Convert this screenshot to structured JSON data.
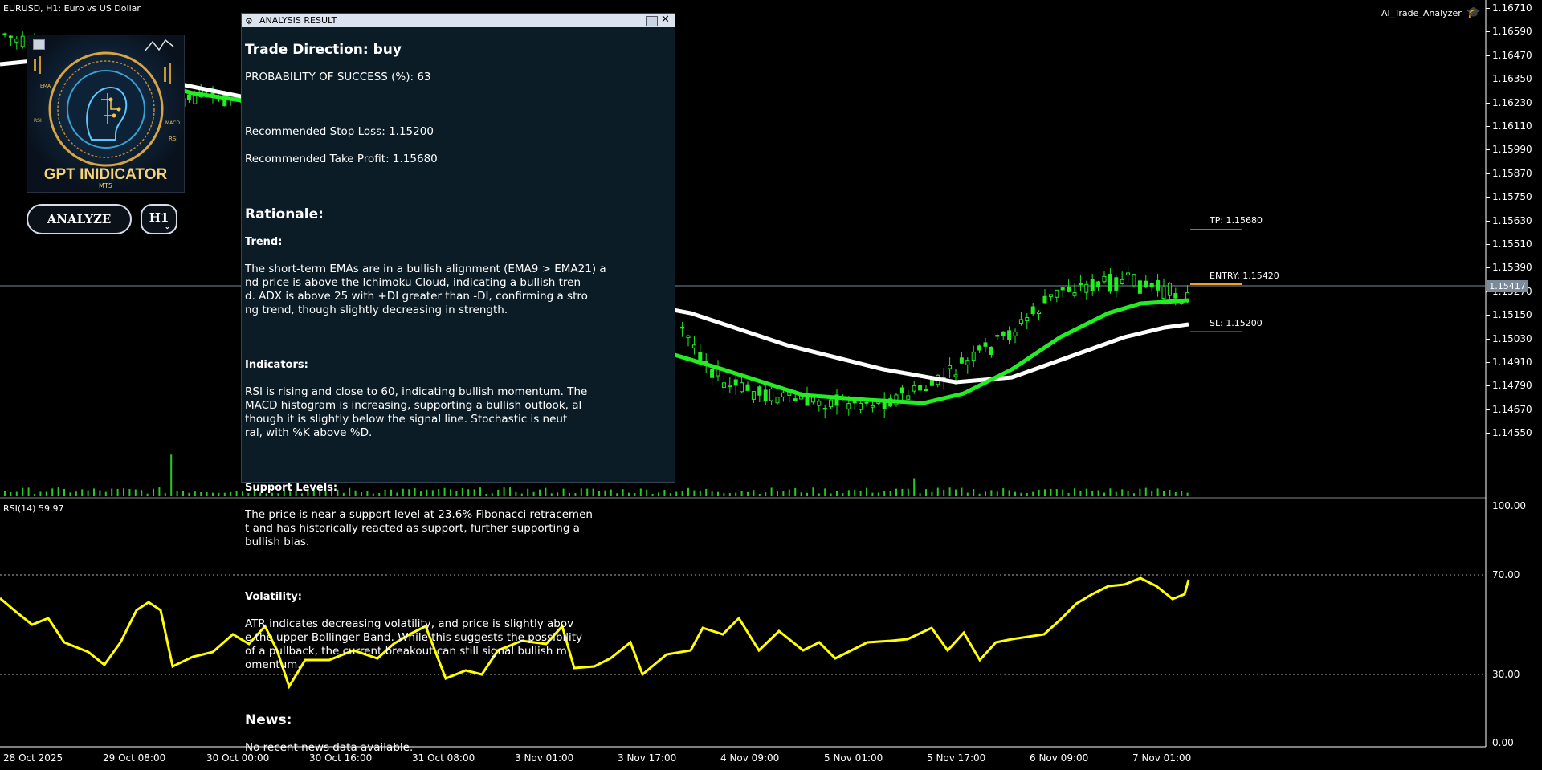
{
  "header": {
    "symbol_info": "EURUSD, H1:  Euro vs US Dollar",
    "ea_name": "AI_Trade_Analyzer"
  },
  "logo": {
    "title": "GPT INIDICATOR",
    "subtitle": "MT5",
    "labels": [
      "EMA",
      "RSI",
      "MACD",
      "RSI"
    ]
  },
  "controls": {
    "analyze_label": "ANALYZE",
    "timeframe_label": "H1"
  },
  "analysis": {
    "window_title": "ANALYSIS RESULT",
    "trade_direction": "Trade Direction: buy",
    "probability": "PROBABILITY OF SUCCESS (%): 63",
    "stop_loss": "Recommended Stop Loss: 1.15200",
    "take_profit": "Recommended Take Profit: 1.15680",
    "rationale_heading": "Rationale:",
    "sections": [
      {
        "heading": "Trend:",
        "text": "The short-term EMAs are in a bullish alignment (EMA9 > EMA21) a\nnd price is above the Ichimoku Cloud, indicating a bullish tren\nd. ADX is above 25 with +DI greater than -DI, confirming a stro\nng trend, though slightly decreasing in strength."
      },
      {
        "heading": "Indicators:",
        "text": "RSI is rising and close to 60, indicating bullish momentum. The\n MACD histogram is increasing, supporting a bullish outlook, al\nthough it is slightly below the signal line. Stochastic is neut\nral, with %K above %D."
      },
      {
        "heading": "Support Levels:",
        "text": "The price is near a support level at 23.6% Fibonacci retracemen\nt and has historically reacted as support, further supporting a\n bullish bias."
      },
      {
        "heading": "Volatility:",
        "text": "ATR indicates decreasing volatility, and price is slightly abov\ne the upper Bollinger Band. While this suggests the possibility\n of a pullback, the current breakout can still signal bullish m\nomentum."
      }
    ],
    "news_heading": "News:",
    "news_text": "No recent news data available."
  },
  "levels": {
    "tp_label": "TP: 1.15680",
    "entry_label": "ENTRY: 1.15420",
    "sl_label": "SL: 1.15200",
    "current_price": "1.15417"
  },
  "colors": {
    "tp": "#00c800",
    "entry": "#f0a030",
    "sl": "#e00000",
    "ema_fast": "#22ee22",
    "ema_slow": "#ffffff",
    "rsi_line": "#ffff00",
    "bull_candle": "#22ee22",
    "volume": "#22cc22"
  },
  "price_axis": [
    "1.16710",
    "1.16590",
    "1.16470",
    "1.16350",
    "1.16230",
    "1.16110",
    "1.15990",
    "1.15870",
    "1.15750",
    "1.15630",
    "1.15510",
    "1.15390",
    "1.15270",
    "1.15150",
    "1.15030",
    "1.14910",
    "1.14790",
    "1.14670",
    "1.14550"
  ],
  "rsi": {
    "label": "RSI(14) 59.97",
    "axis": [
      "100.00",
      "70.00",
      "30.00",
      "0.00"
    ]
  },
  "time_axis": [
    "28 Oct 2025",
    "29 Oct 08:00",
    "30 Oct 00:00",
    "30 Oct 16:00",
    "31 Oct 08:00",
    "3 Nov 01:00",
    "3 Nov 17:00",
    "4 Nov 09:00",
    "5 Nov 01:00",
    "5 Nov 17:00",
    "6 Nov 09:00",
    "7 Nov 01:00"
  ]
}
